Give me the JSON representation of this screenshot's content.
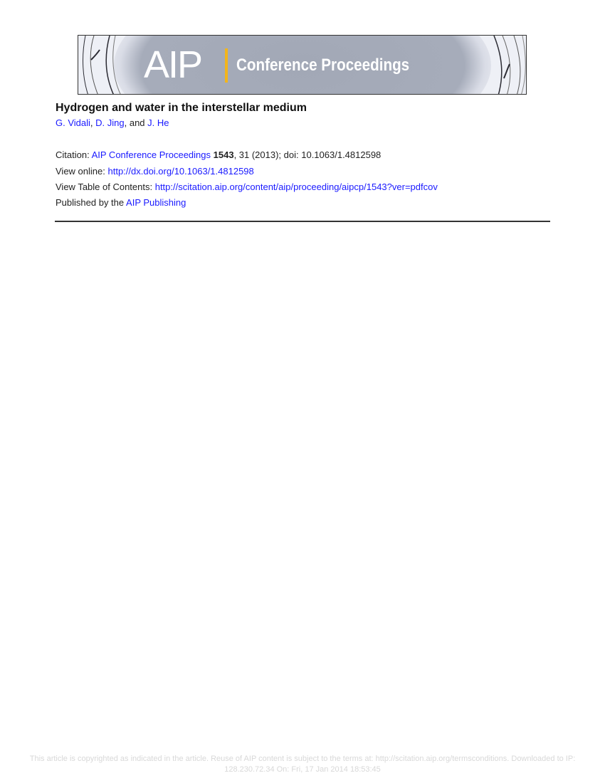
{
  "banner": {
    "logo_text": "AIP",
    "subtitle": "Conference Proceedings",
    "accent_color": "#f2b51b"
  },
  "article": {
    "title": "Hydrogen and water in the interstellar medium",
    "authors": [
      {
        "name": "G. Vidali"
      },
      {
        "name": "D. Jing"
      },
      {
        "name": "J. He"
      }
    ],
    "author_sep_1": ", ",
    "author_sep_2": ", and "
  },
  "citation": {
    "label": "Citation: ",
    "journal": "AIP Conference Proceedings",
    "volume": "1543",
    "rest": ", 31 (2013); doi: 10.1063/1.4812598"
  },
  "view_online": {
    "label": "View online: ",
    "url": "http://dx.doi.org/10.1063/1.4812598"
  },
  "toc": {
    "label": "View Table of Contents: ",
    "url": "http://scitation.aip.org/content/aip/proceeding/aipcp/1543?ver=pdfcov"
  },
  "publisher": {
    "label": "Published by the ",
    "name": "AIP Publishing"
  },
  "footer": {
    "line1": "This article is copyrighted as indicated in the article. Reuse of AIP content is subject to the terms at: http://scitation.aip.org/termsconditions. Downloaded to  IP:",
    "line2": "128.230.72.34 On: Fri, 17 Jan 2014 18:53:45"
  },
  "colors": {
    "link": "#1a1aff",
    "footer_text": "#d8d8d8"
  }
}
